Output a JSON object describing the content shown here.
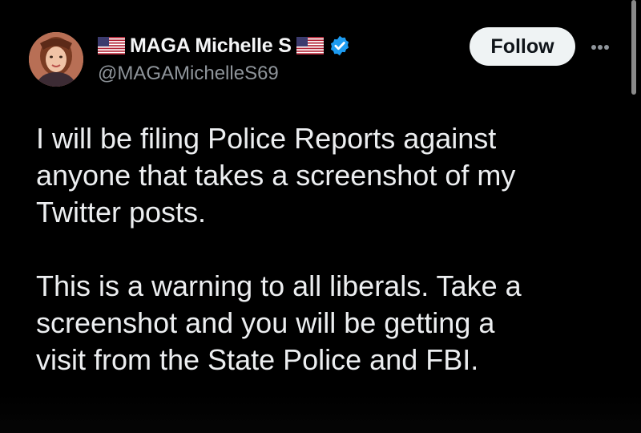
{
  "tweet": {
    "author": {
      "display_name": "MAGA Michelle S",
      "handle": "@MAGAMichelleS69",
      "verified": true,
      "flag_icon": "us-flag-icon"
    },
    "follow_label": "Follow",
    "more_icon": "more-horizontal-icon",
    "paragraphs": [
      "I will be filing Police Reports against\nanyone that takes a screenshot of my\nTwitter posts.",
      "This is a warning to all liberals. Take a\nscreenshot and you will be getting a\nvisit from the State Police and FBI."
    ]
  },
  "colors": {
    "background": "#000000",
    "text": "#e7e9ea",
    "secondary_text": "#8f959b",
    "verified_badge": "#1d9bf0",
    "follow_button_bg": "#eff3f4",
    "follow_button_text": "#0f1419"
  }
}
